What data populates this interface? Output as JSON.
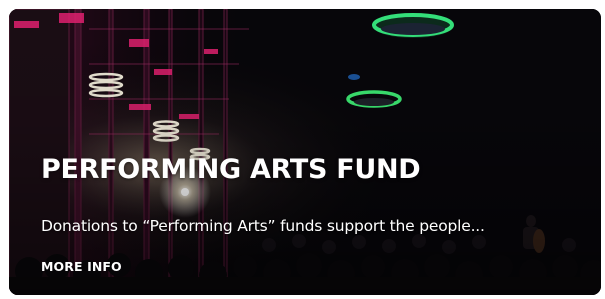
{
  "card": {
    "title": "PERFORMING ARTS FUND",
    "description": "Donations to “Performing Arts” funds support the people...",
    "link_label": "MORE INFO"
  }
}
